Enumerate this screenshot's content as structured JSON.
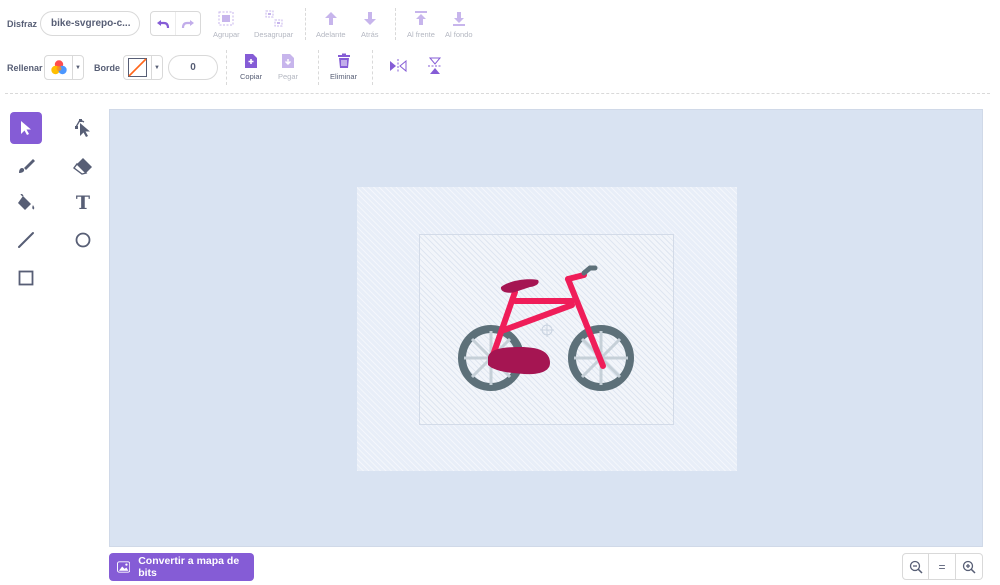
{
  "toolbar": {
    "costume_label": "Disfraz",
    "costume_name": "bike-svgrepo-c...",
    "group_label": "Agrupar",
    "ungroup_label": "Desagrupar",
    "forward_label": "Adelante",
    "backward_label": "Atrás",
    "front_label": "Al frente",
    "back_label": "Al fondo",
    "fill_label": "Rellenar",
    "outline_label": "Borde",
    "outline_width": "0",
    "copy_label": "Copiar",
    "paste_label": "Pegar",
    "delete_label": "Eliminar"
  },
  "tools": {
    "selected": "select",
    "items": [
      "select",
      "reshape",
      "brush",
      "eraser",
      "fill",
      "text",
      "line",
      "circle",
      "rectangle"
    ],
    "text_glyph": "T"
  },
  "canvas": {
    "convert_label": "Convertir a mapa de bits"
  },
  "zoom": {
    "reset_label": "="
  },
  "colors": {
    "accent": "#855cd6",
    "canvas_bg": "#d9e3f2",
    "bike_frame": "#ef1d59",
    "bike_seat": "#a51552",
    "bike_wheel": "#5d7079"
  }
}
